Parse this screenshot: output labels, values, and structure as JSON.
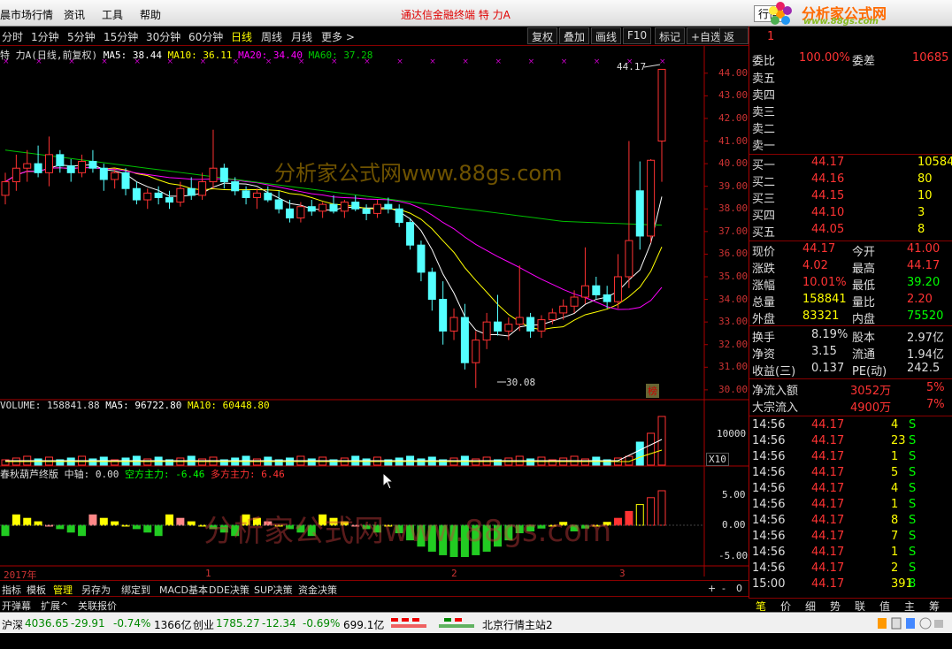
{
  "menu": {
    "items": [
      "晨市场行情",
      "资讯",
      "工具",
      "帮助"
    ],
    "center_title": "通达信金融终端   特 力A",
    "right_button": "行情",
    "logo_text": "分析家公式网",
    "logo_url": "www.88gs.com"
  },
  "periods": [
    "分时",
    "1分钟",
    "5分钟",
    "15分钟",
    "30分钟",
    "60分钟",
    "日线",
    "周线",
    "月线",
    "更多 >"
  ],
  "active_period": "日线",
  "toolbar_buttons": [
    "复权",
    "叠加",
    "画线",
    "F10",
    "标记",
    "+自选",
    "返回"
  ],
  "main_legend": {
    "name": "特 力A(日线,前复权)",
    "ma5": "MA5: 38.44",
    "ma10": "MA10: 36.11",
    "ma20": "MA20: 34.40",
    "ma60": "MA60: 37.28"
  },
  "price_axis": [
    "44.00",
    "43.00",
    "42.00",
    "41.00",
    "40.00",
    "39.00",
    "38.00",
    "37.00",
    "36.00",
    "35.00",
    "34.00",
    "33.00",
    "32.00",
    "31.00",
    "30.00"
  ],
  "high_label": "44.17",
  "low_label": "30.08",
  "watermark": "分析家公式网www.88gs.com",
  "bang_label": "榜",
  "volume_legend": {
    "vol": "VOLUME: 158841.88",
    "ma5": "MA5: 96722.80",
    "ma10": "MA10: 60448.80"
  },
  "volume_axis": {
    "tick": "10000",
    "unit": "X10"
  },
  "indicator_legend": {
    "name": "春秋葫芦终版",
    "axis": "中轴: 0.00",
    "bear": "空方主力: -6.46",
    "bull": "多方主力: 6.46"
  },
  "indicator_axis": [
    "5.00",
    "0.00",
    "-5.00"
  ],
  "time_labels": {
    "year": "2017年",
    "m1": "1",
    "m2": "2",
    "m3": "3"
  },
  "bottom_tabs": [
    "指标",
    "模板",
    "管理",
    "另存为",
    "绑定到",
    "MACD基本",
    "DDE决策",
    "SUP决策",
    "资金决策"
  ],
  "bottom_tabs2": [
    "开弹幕",
    "扩展^",
    "关联报价"
  ],
  "zoom_buttons": [
    "+",
    "-",
    "0"
  ],
  "quote": {
    "header_left": "1",
    "weibi_label": "委比",
    "weibi_val": "100.00%",
    "weicha_label": "委差",
    "weicha_val": "10685",
    "sell": [
      "卖五",
      "卖四",
      "卖三",
      "卖二",
      "卖一"
    ],
    "buy": [
      {
        "label": "买一",
        "price": "44.17",
        "vol": "10584"
      },
      {
        "label": "买二",
        "price": "44.16",
        "vol": "80"
      },
      {
        "label": "买三",
        "price": "44.15",
        "vol": "10"
      },
      {
        "label": "买四",
        "price": "44.10",
        "vol": "3"
      },
      {
        "label": "买五",
        "price": "44.05",
        "vol": "8"
      }
    ],
    "stats": [
      {
        "l1": "现价",
        "v1": "44.17",
        "l2": "今开",
        "v2": "41.00"
      },
      {
        "l1": "涨跌",
        "v1": "4.02",
        "l2": "最高",
        "v2": "44.17"
      },
      {
        "l1": "涨幅",
        "v1": "10.01%",
        "l2": "最低",
        "v2": "39.20"
      },
      {
        "l1": "总量",
        "v1": "158841",
        "l2": "量比",
        "v2": "2.20"
      },
      {
        "l1": "外盘",
        "v1": "83321",
        "l2": "内盘",
        "v2": "75520"
      }
    ],
    "stats2": [
      {
        "l1": "换手",
        "v1": "8.19%",
        "l2": "股本",
        "v2": "2.97亿"
      },
      {
        "l1": "净资",
        "v1": "3.15",
        "l2": "流通",
        "v2": "1.94亿"
      },
      {
        "l1": "收益(三)",
        "v1": "0.137",
        "l2": "PE(动)",
        "v2": "242.5"
      }
    ],
    "flow": [
      {
        "label": "净流入额",
        "val": "3052万",
        "pct": "5%"
      },
      {
        "label": "大宗流入",
        "val": "4900万",
        "pct": "7%"
      }
    ],
    "ticks": [
      {
        "t": "14:56",
        "p": "44.17",
        "v": "4",
        "s": "S"
      },
      {
        "t": "14:56",
        "p": "44.17",
        "v": "23",
        "s": "S"
      },
      {
        "t": "14:56",
        "p": "44.17",
        "v": "1",
        "s": "S"
      },
      {
        "t": "14:56",
        "p": "44.17",
        "v": "5",
        "s": "S"
      },
      {
        "t": "14:56",
        "p": "44.17",
        "v": "4",
        "s": "S"
      },
      {
        "t": "14:56",
        "p": "44.17",
        "v": "1",
        "s": "S"
      },
      {
        "t": "14:56",
        "p": "44.17",
        "v": "8",
        "s": "S"
      },
      {
        "t": "14:56",
        "p": "44.17",
        "v": "7",
        "s": "S"
      },
      {
        "t": "14:56",
        "p": "44.17",
        "v": "1",
        "s": "S"
      },
      {
        "t": "14:56",
        "p": "44.17",
        "v": "2",
        "s": "S"
      },
      {
        "t": "15:00",
        "p": "44.17",
        "v": "391",
        "s": "8"
      }
    ],
    "tabs": [
      "笔",
      "价",
      "细",
      "势",
      "联",
      "值",
      "主",
      "筹"
    ]
  },
  "status": {
    "sh_label": "沪深",
    "sh_val": "4036.65",
    "sh_chg": "-29.91",
    "sh_pct": "-0.74%",
    "sh_amt": "1366亿",
    "cy_label": "创业",
    "cy_val": "1785.27",
    "cy_chg": "-12.34",
    "cy_pct": "-0.69%",
    "cy_amt": "699.1亿",
    "server": "北京行情主站2"
  },
  "colors": {
    "up": "#ff3232",
    "down": "#54ffff",
    "ma5": "#ffffff",
    "ma10": "#ffff00",
    "ma20": "#ff00ff",
    "ma60": "#00c000"
  },
  "chart_data": {
    "type": "candlestick",
    "ohlc": [
      [
        38.6,
        39.6,
        38.2,
        39.2
      ],
      [
        39.2,
        40.4,
        38.8,
        39.8
      ],
      [
        39.8,
        40.6,
        39.2,
        40.0
      ],
      [
        40.0,
        40.8,
        39.4,
        39.6
      ],
      [
        39.6,
        41.2,
        39.0,
        40.4
      ],
      [
        40.4,
        40.6,
        39.6,
        39.9
      ],
      [
        39.9,
        40.2,
        39.2,
        39.6
      ],
      [
        39.6,
        40.4,
        39.4,
        40.1
      ],
      [
        40.1,
        40.6,
        39.6,
        39.8
      ],
      [
        39.8,
        40.0,
        38.8,
        39.3
      ],
      [
        39.3,
        39.8,
        38.9,
        39.6
      ],
      [
        39.6,
        39.8,
        38.6,
        38.9
      ],
      [
        38.9,
        39.2,
        38.2,
        38.4
      ],
      [
        38.4,
        38.9,
        38.0,
        38.7
      ],
      [
        38.7,
        39.0,
        38.2,
        38.5
      ],
      [
        38.5,
        38.8,
        38.0,
        38.3
      ],
      [
        38.3,
        39.2,
        38.1,
        38.9
      ],
      [
        38.9,
        39.4,
        38.4,
        38.6
      ],
      [
        38.6,
        39.6,
        38.4,
        39.2
      ],
      [
        39.2,
        41.5,
        38.9,
        39.8
      ],
      [
        39.8,
        40.0,
        38.9,
        39.2
      ],
      [
        39.2,
        39.4,
        38.6,
        38.8
      ],
      [
        38.8,
        39.0,
        38.2,
        38.5
      ],
      [
        38.5,
        38.9,
        38.0,
        38.7
      ],
      [
        38.7,
        39.0,
        38.3,
        38.4
      ],
      [
        38.4,
        38.8,
        37.8,
        38.0
      ],
      [
        38.0,
        38.4,
        37.4,
        37.6
      ],
      [
        37.6,
        38.3,
        37.4,
        38.1
      ],
      [
        38.1,
        38.4,
        37.7,
        37.9
      ],
      [
        37.9,
        38.3,
        37.6,
        38.2
      ],
      [
        38.2,
        38.6,
        37.8,
        37.9
      ],
      [
        37.9,
        38.4,
        37.6,
        38.3
      ],
      [
        38.3,
        38.6,
        37.9,
        38.0
      ],
      [
        38.0,
        38.2,
        37.5,
        37.8
      ],
      [
        37.8,
        38.4,
        37.6,
        38.2
      ],
      [
        38.2,
        38.5,
        37.8,
        38.0
      ],
      [
        38.0,
        38.2,
        37.2,
        37.4
      ],
      [
        37.4,
        37.6,
        36.2,
        36.4
      ],
      [
        36.4,
        36.6,
        34.8,
        35.2
      ],
      [
        35.2,
        35.4,
        33.5,
        34.0
      ],
      [
        34.0,
        34.8,
        32.0,
        32.6
      ],
      [
        32.6,
        33.6,
        32.2,
        33.2
      ],
      [
        33.2,
        33.8,
        30.9,
        31.2
      ],
      [
        31.2,
        32.6,
        30.08,
        32.2
      ],
      [
        32.2,
        33.4,
        31.8,
        33.0
      ],
      [
        33.0,
        34.2,
        32.4,
        32.6
      ],
      [
        32.6,
        33.2,
        32.2,
        32.9
      ],
      [
        32.9,
        35.5,
        32.6,
        33.2
      ],
      [
        33.2,
        33.4,
        32.3,
        32.6
      ],
      [
        32.6,
        33.3,
        32.3,
        33.1
      ],
      [
        33.1,
        33.6,
        32.9,
        33.4
      ],
      [
        33.4,
        34.0,
        33.1,
        33.7
      ],
      [
        33.7,
        34.4,
        33.4,
        34.1
      ],
      [
        34.1,
        36.3,
        33.8,
        34.6
      ],
      [
        34.6,
        35.0,
        34.0,
        34.2
      ],
      [
        34.2,
        34.6,
        33.6,
        33.9
      ],
      [
        33.9,
        36.0,
        33.6,
        35.0
      ],
      [
        35.0,
        41.0,
        34.5,
        36.6
      ],
      [
        38.8,
        40.1,
        36.2,
        36.8
      ],
      [
        36.8,
        40.2,
        36.5,
        40.15
      ],
      [
        41.0,
        44.17,
        39.2,
        44.17
      ]
    ],
    "ma5_end": 38.44,
    "ma10_end": 36.11,
    "ma20_end": 34.4,
    "ma60_end": 37.28,
    "price_range": [
      29.8,
      44.5
    ]
  }
}
